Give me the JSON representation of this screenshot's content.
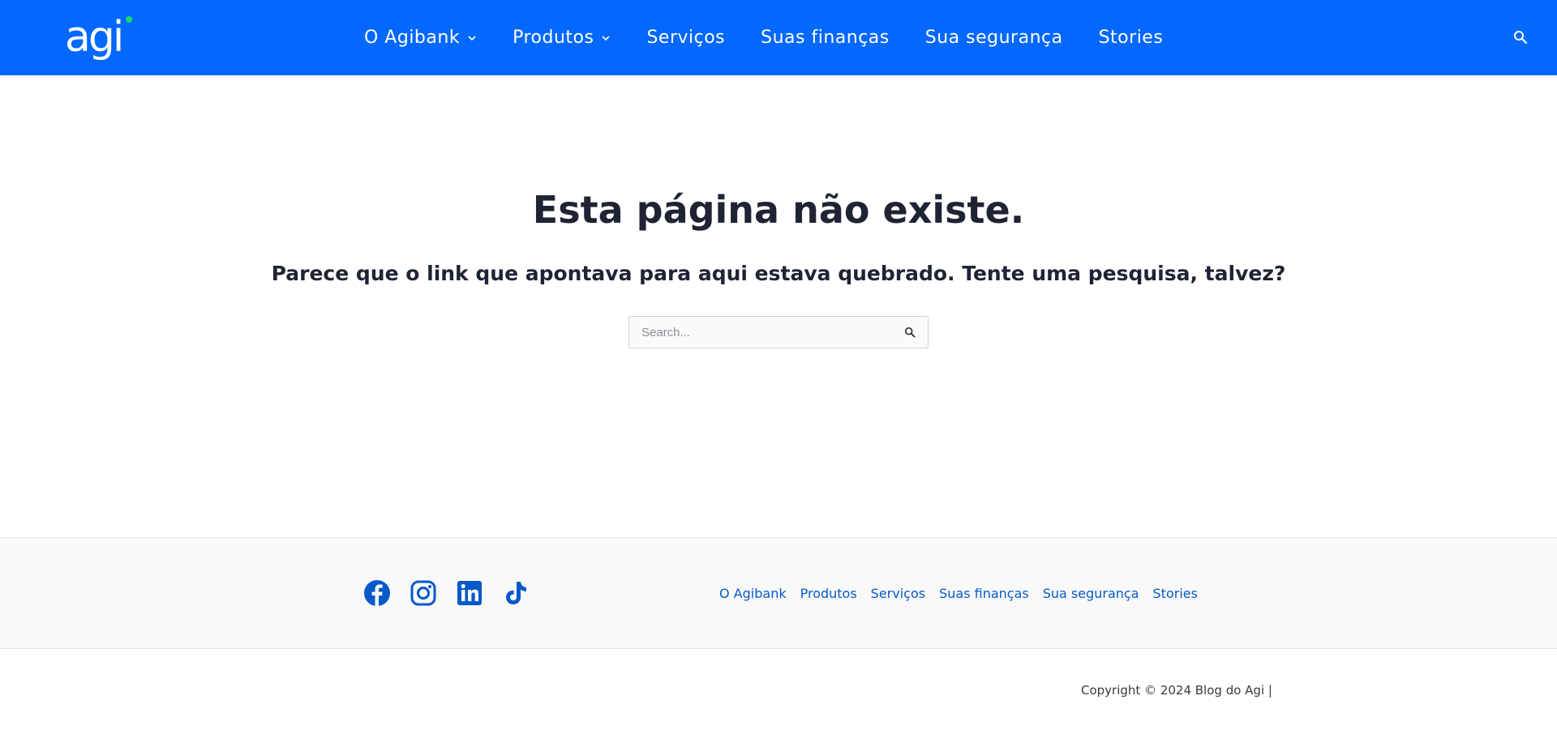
{
  "header": {
    "logo_text": "agi",
    "logo_dot_color": "#1bdc6b",
    "background_color": "#0368fe",
    "nav": [
      {
        "label": "O Agibank",
        "has_dropdown": true
      },
      {
        "label": "Produtos",
        "has_dropdown": true
      },
      {
        "label": "Serviços",
        "has_dropdown": false
      },
      {
        "label": "Suas finanças",
        "has_dropdown": false
      },
      {
        "label": "Sua segurança",
        "has_dropdown": false
      },
      {
        "label": "Stories",
        "has_dropdown": false
      }
    ],
    "search_icon": "search-icon"
  },
  "main": {
    "title": "Esta página não existe.",
    "subtitle": "Parece que o link que apontava para aqui estava quebrado. Tente uma pesquisa, talvez?",
    "search": {
      "placeholder": "Search...",
      "value": "",
      "button_icon": "search-icon"
    }
  },
  "footer": {
    "social": [
      {
        "name": "facebook-icon"
      },
      {
        "name": "instagram-icon"
      },
      {
        "name": "linkedin-icon"
      },
      {
        "name": "tiktok-icon"
      }
    ],
    "links": [
      "O Agibank",
      "Produtos",
      "Serviços",
      "Suas finanças",
      "Sua segurança",
      "Stories"
    ],
    "link_color": "#0659c9",
    "copyright": "Copyright © 2024 Blog do Agi |"
  }
}
